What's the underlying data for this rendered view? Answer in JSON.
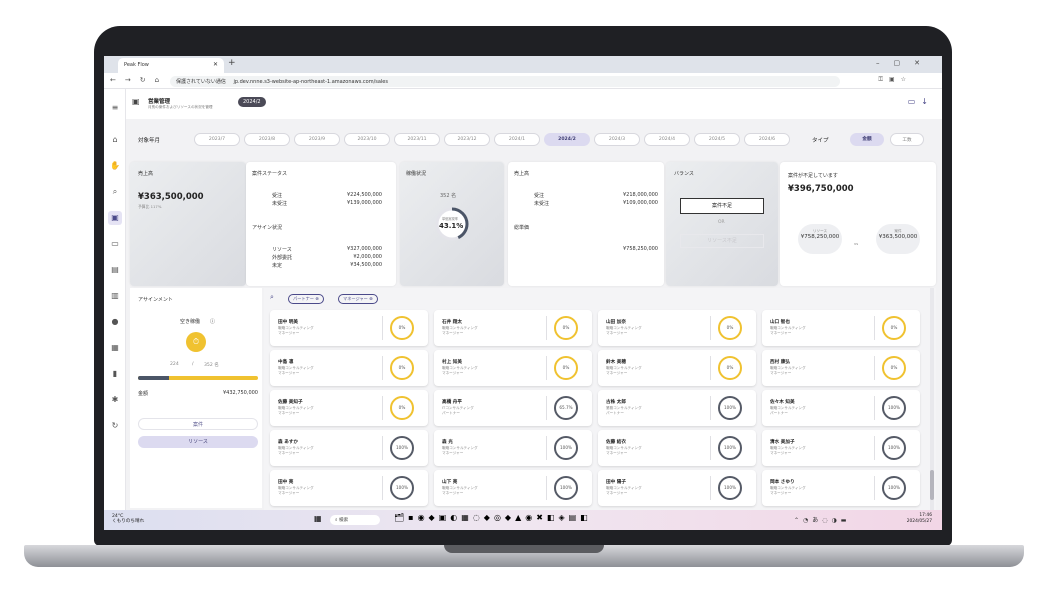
{
  "browser": {
    "tab_title": "Peak Flow",
    "url_warning": "保護されていない通信",
    "url": "jp.dev.nnne.s3-website-ap-northeast-1.amazonaws.com/sales"
  },
  "header": {
    "title": "営業管理",
    "subtitle": "月別の案件およびリソースの状況を管理",
    "badge": "2024/2"
  },
  "filter": {
    "label": "対象年月",
    "months": [
      "2023/7",
      "2023/8",
      "2023/9",
      "2023/10",
      "2023/11",
      "2023/12",
      "2024/1",
      "2024/2",
      "2024/3",
      "2024/4",
      "2024/5",
      "2024/6"
    ],
    "active_month": "2024/2",
    "type_label": "タイプ",
    "type_on": "金額",
    "type_off": "工数"
  },
  "sales": {
    "title": "売上高",
    "value": "¥363,500,000",
    "sub": "予算比 117%"
  },
  "deal_status": {
    "title": "案件ステータス",
    "rows": [
      {
        "label": "受注",
        "value": "¥224,500,000"
      },
      {
        "label": "未受注",
        "value": "¥139,000,000"
      }
    ],
    "assign_title": "アサイン状況",
    "assign_rows": [
      {
        "label": "リソース",
        "value": "¥327,000,000"
      },
      {
        "label": "外部委託",
        "value": "¥2,000,000"
      },
      {
        "label": "未定",
        "value": "¥34,500,000"
      }
    ]
  },
  "operation": {
    "title": "稼働状況",
    "people": "352 名",
    "ring_label": "単価実現率",
    "ring_value": "43.1%",
    "ring_pct": 43.1
  },
  "revenue": {
    "title": "売上高",
    "rows": [
      {
        "label": "受注",
        "value": "¥218,000,000"
      },
      {
        "label": "未受注",
        "value": "¥109,000,000"
      }
    ],
    "total_label": "総単価",
    "total_value": "¥758,250,000"
  },
  "balance": {
    "title": "バランス",
    "btn_shortage": "案件不足",
    "or": "OR",
    "btn_resource": "リソース不足"
  },
  "shortage": {
    "title": "案件が不足しています",
    "value": "¥396,750,000",
    "left_label": "リソース",
    "left_value": "¥758,250,000",
    "vs": "vs",
    "right_label": "案件",
    "right_value": "¥363,500,000"
  },
  "assignment": {
    "title": "アサインメント",
    "sub": "空き稼働",
    "count_a": "224",
    "sep": "/",
    "count_b": "352 名",
    "progress": 0.26,
    "amount_label": "金額",
    "amount_value": "¥432,750,000",
    "btn_deal": "案件",
    "btn_resource": "リソース"
  },
  "chips": [
    "パートナー",
    "マネージャー"
  ],
  "people": [
    {
      "name": "田中 明美",
      "dept": "戦略コンサルティング",
      "role": "マネージャー",
      "pct": "0%",
      "color": "y"
    },
    {
      "name": "石井 翔太",
      "dept": "戦略コンサルティング",
      "role": "マネージャー",
      "pct": "0%",
      "color": "y"
    },
    {
      "name": "山田 加奈",
      "dept": "戦略コンサルティング",
      "role": "マネージャー",
      "pct": "0%",
      "color": "y"
    },
    {
      "name": "山口 智也",
      "dept": "戦略コンサルティング",
      "role": "マネージャー",
      "pct": "0%",
      "color": "y"
    },
    {
      "name": "中島 凛",
      "dept": "戦略コンサルティング",
      "role": "マネージャー",
      "pct": "0%",
      "color": "y"
    },
    {
      "name": "村上 知美",
      "dept": "戦略コンサルティング",
      "role": "マネージャー",
      "pct": "0%",
      "color": "y"
    },
    {
      "name": "鈴木 美穂",
      "dept": "戦略コンサルティング",
      "role": "マネージャー",
      "pct": "0%",
      "color": "y"
    },
    {
      "name": "西村 康弘",
      "dept": "戦略コンサルティング",
      "role": "マネージャー",
      "pct": "0%",
      "color": "y"
    },
    {
      "name": "佐藤 美知子",
      "dept": "戦略コンサルティング",
      "role": "マネージャー",
      "pct": "0%",
      "color": "y"
    },
    {
      "name": "高橋 舟平",
      "dept": "ITコンサルティング",
      "role": "パートナー",
      "pct": "65.7%",
      "color": "g"
    },
    {
      "name": "古株 太郎",
      "dept": "業務コンサルティング",
      "role": "パートナー",
      "pct": "100%",
      "color": "g"
    },
    {
      "name": "佐々木 知美",
      "dept": "戦略コンサルティング",
      "role": "パートナー",
      "pct": "100%",
      "color": "g"
    },
    {
      "name": "森 あすか",
      "dept": "戦略コンサルティング",
      "role": "マネージャー",
      "pct": "100%",
      "color": "g"
    },
    {
      "name": "森 光",
      "dept": "戦略コンサルティング",
      "role": "マネージャー",
      "pct": "100%",
      "color": "g"
    },
    {
      "name": "佐藤 結衣",
      "dept": "戦略コンサルティング",
      "role": "マネージャー",
      "pct": "100%",
      "color": "g"
    },
    {
      "name": "清水 美加子",
      "dept": "戦略コンサルティング",
      "role": "マネージャー",
      "pct": "100%",
      "color": "g"
    },
    {
      "name": "田中 亮",
      "dept": "戦略コンサルティング",
      "role": "マネージャー",
      "pct": "100%",
      "color": "g"
    },
    {
      "name": "山下 亮",
      "dept": "戦略コンサルティング",
      "role": "マネージャー",
      "pct": "100%",
      "color": "g"
    },
    {
      "name": "田中 陽子",
      "dept": "戦略コンサルティング",
      "role": "マネージャー",
      "pct": "100%",
      "color": "g"
    },
    {
      "name": "岡本 さゆり",
      "dept": "戦略コンサルティング",
      "role": "マネージャー",
      "pct": "100%",
      "color": "g"
    }
  ],
  "taskbar": {
    "temp": "24°C",
    "weather": "くもりのち晴れ",
    "search": "検索",
    "time": "17:46",
    "date": "2024/05/27"
  },
  "colors": {
    "accent": "#4b4a8a",
    "yellow": "#f0c230",
    "dark": "#4b5567"
  }
}
